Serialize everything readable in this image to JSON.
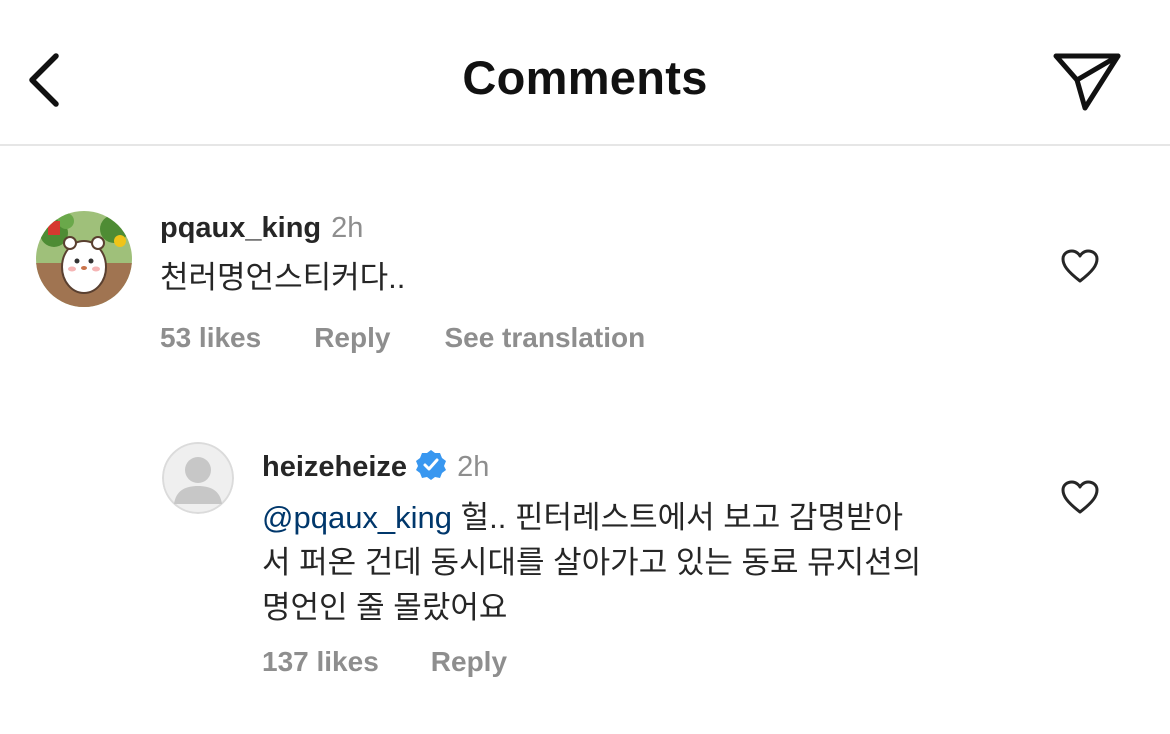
{
  "header": {
    "title": "Comments",
    "back_icon": "chevron-left-icon",
    "share_icon": "paper-plane-icon"
  },
  "comments": [
    {
      "username": "pqaux_king",
      "time": "2h",
      "text": "천러명언스티커다..",
      "likes": "53 likes",
      "reply": "Reply",
      "translate": "See translation"
    }
  ],
  "replies": [
    {
      "username": "heizeheize",
      "verified": true,
      "time": "2h",
      "mention": "@pqaux_king",
      "line1": " 헐.. 핀터레스트에서 보고 감명받아",
      "line2": "서 퍼온 건데 동시대를 살아가고 있는 동료 뮤지션의",
      "line3": "명언인 줄 몰랐어요",
      "likes": "137 likes",
      "reply": "Reply"
    }
  ],
  "colors": {
    "mention": "#00376b",
    "verified": "#3897f0",
    "secondary_text": "#8e8e8e"
  }
}
